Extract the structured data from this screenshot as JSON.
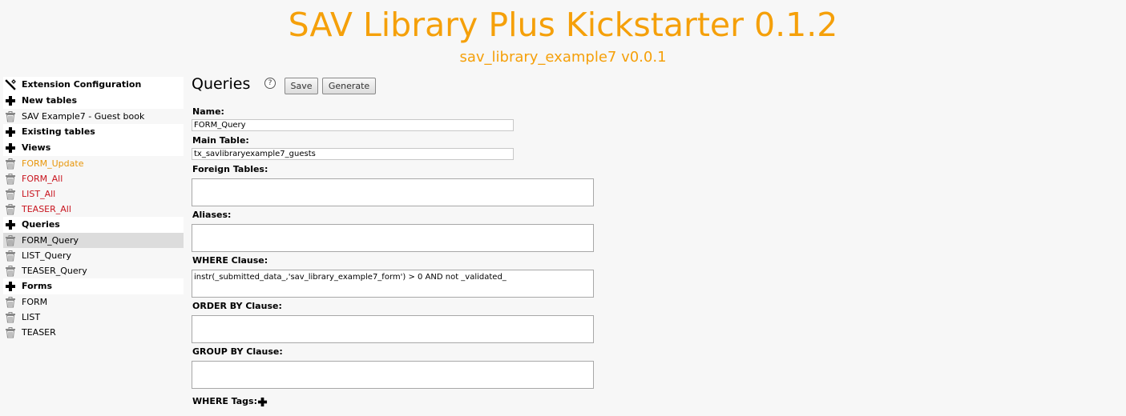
{
  "header": {
    "title": "SAV Library Plus Kickstarter 0.1.2",
    "subtitle": "sav_library_example7 v0.0.1"
  },
  "sidebar": {
    "items": [
      {
        "label": "Extension Configuration",
        "icon": "wrench-icon",
        "kind": "section"
      },
      {
        "label": "New tables",
        "icon": "plus-icon",
        "kind": "section"
      },
      {
        "label": "SAV Example7 - Guest book",
        "icon": "trash-icon",
        "kind": "item"
      },
      {
        "label": "Existing tables",
        "icon": "plus-icon",
        "kind": "section"
      },
      {
        "label": "Views",
        "icon": "plus-icon",
        "kind": "section"
      },
      {
        "label": "FORM_Update",
        "icon": "trash-icon",
        "kind": "item",
        "color": "#e8960a"
      },
      {
        "label": "FORM_All",
        "icon": "trash-icon",
        "kind": "item",
        "color": "#c8141e"
      },
      {
        "label": "LIST_All",
        "icon": "trash-icon",
        "kind": "item",
        "color": "#c8141e"
      },
      {
        "label": "TEASER_All",
        "icon": "trash-icon",
        "kind": "item",
        "color": "#c8141e"
      },
      {
        "label": "Queries",
        "icon": "plus-icon",
        "kind": "section"
      },
      {
        "label": "FORM_Query",
        "icon": "trash-icon",
        "kind": "item",
        "selected": true
      },
      {
        "label": "LIST_Query",
        "icon": "trash-icon",
        "kind": "item"
      },
      {
        "label": "TEASER_Query",
        "icon": "trash-icon",
        "kind": "item"
      },
      {
        "label": "Forms",
        "icon": "plus-icon",
        "kind": "section"
      },
      {
        "label": "FORM",
        "icon": "trash-icon",
        "kind": "item"
      },
      {
        "label": "LIST",
        "icon": "trash-icon",
        "kind": "item"
      },
      {
        "label": "TEASER",
        "icon": "trash-icon",
        "kind": "item"
      }
    ]
  },
  "main": {
    "title": "Queries",
    "help_icon": "help-icon",
    "save_label": "Save",
    "generate_label": "Generate",
    "name_label": "Name:",
    "name_value": "FORM_Query",
    "main_table_label": "Main Table:",
    "main_table_value": "tx_savlibraryexample7_guests",
    "foreign_tables_label": "Foreign Tables:",
    "foreign_tables_value": "",
    "aliases_label": "Aliases:",
    "aliases_value": "",
    "where_label": "WHERE Clause:",
    "where_value": "instr(_submitted_data_,'sav_library_example7_form') > 0 AND not _validated_",
    "order_by_label": "ORDER BY Clause:",
    "order_by_value": "",
    "group_by_label": "GROUP BY Clause:",
    "group_by_value": "",
    "where_tags_label": "WHERE Tags:",
    "where_tags_icon": "plus-icon"
  },
  "colors": {
    "brand": "#f5a00a",
    "view_active": "#e8960a",
    "view_error": "#c8141e",
    "selected_bg": "#dcdcdc"
  }
}
